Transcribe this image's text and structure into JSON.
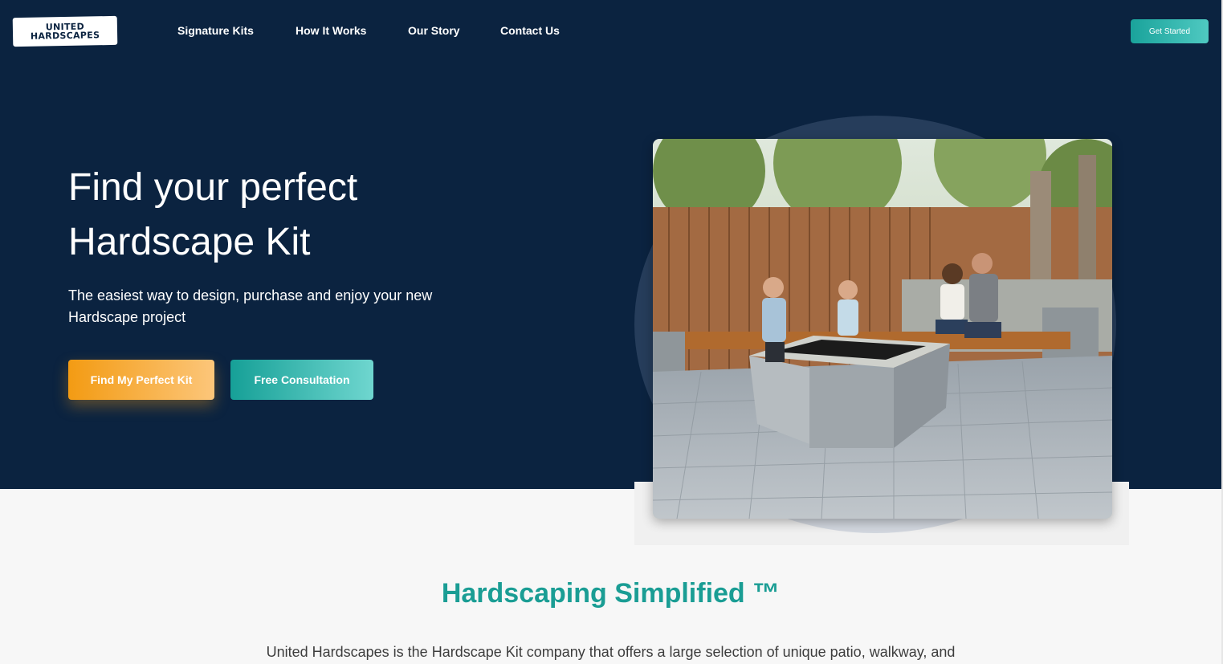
{
  "header": {
    "logo_line1": "UNITED",
    "logo_line2": "HARDSCAPES",
    "nav": [
      "Signature Kits",
      "How It Works",
      "Our Story",
      "Contact Us"
    ],
    "cta": "Get Started"
  },
  "hero": {
    "title_line1": "Find your perfect",
    "title_line2": "Hardscape Kit",
    "subtitle_line1": "The easiest way to design, purchase and enjoy your new",
    "subtitle_line2": "Hardscape project",
    "primary_button": "Find My Perfect Kit",
    "secondary_button": "Free Consultation",
    "image": "family-around-fire-pit-patio"
  },
  "section": {
    "title": "Hardscaping Simplified ™",
    "text": "United Hardscapes is the Hardscape Kit company that offers a large selection of unique patio, walkway, and"
  },
  "colors": {
    "navy": "#0b2340",
    "teal": "#1aa39b",
    "orange": "#f39b13"
  }
}
